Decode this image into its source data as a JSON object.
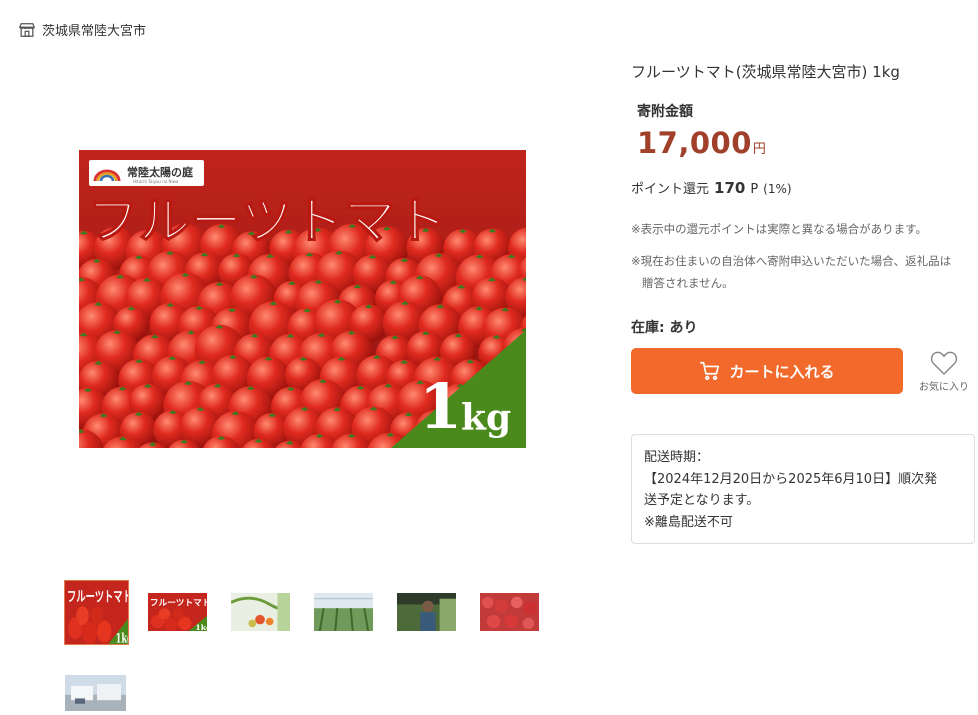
{
  "municipality": {
    "name": "茨城県常陸大宮市",
    "icon": "storefront-icon"
  },
  "gallery": {
    "main_image": {
      "brand": "常陸太陽の庭",
      "brand_sub": "Hitachi Taiyou no Niwa",
      "headline": "フルーツトマト",
      "badge_number": "1",
      "badge_unit": "kg"
    },
    "thumbnails": [
      {
        "kind": "tomato-main",
        "selected": true
      },
      {
        "kind": "tomato-main",
        "selected": false
      },
      {
        "kind": "tomato-vine",
        "selected": false
      },
      {
        "kind": "greenhouse",
        "selected": false
      },
      {
        "kind": "worker",
        "selected": false
      },
      {
        "kind": "tomato-pile",
        "selected": false
      },
      {
        "kind": "facility",
        "selected": false
      }
    ]
  },
  "product": {
    "title": "フルーツトマト(茨城県常陸大宮市) 1kg",
    "price_label": "寄附金額",
    "price": "17,000",
    "currency": "円",
    "points_label": "ポイント還元",
    "points_value": "170",
    "points_unit": "P",
    "points_rate": "(1%)",
    "note_points": "※表示中の還元ポイントは実際と異なる場合があります。",
    "note_residence_1": "※現在お住まいの自治体へ寄附申込いただいた場合、返礼品は",
    "note_residence_2": "贈答されません。",
    "stock": "在庫: あり"
  },
  "actions": {
    "cart_label": "カートに入れる",
    "favorite_label": "お気に入り"
  },
  "shipping": {
    "line1": "配送時期：",
    "line2": "【2024年12月20日から2025年6月10日】順次発",
    "line3": "送予定となります。",
    "line4": "※離島配送不可"
  },
  "colors": {
    "accent": "#f26a2b",
    "price": "#a0402a",
    "badge_green": "#4a8a1c",
    "tomato_red": "#d8261f"
  }
}
